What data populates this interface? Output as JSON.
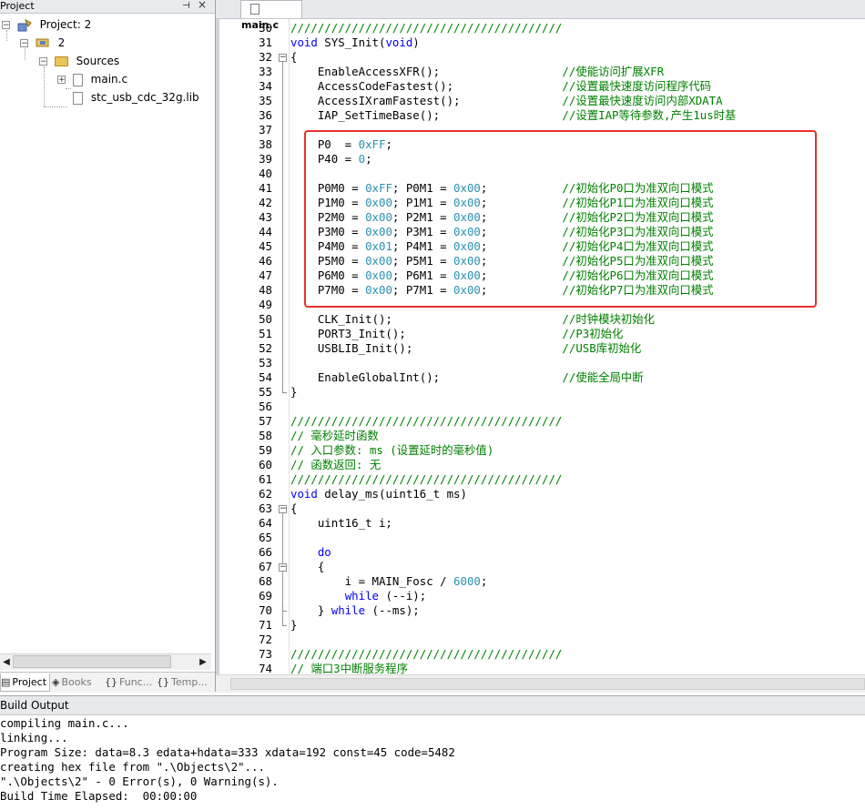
{
  "project_panel": {
    "title": "Project",
    "pin_icon": "pin-icon",
    "close_icon": "close-icon",
    "tree": [
      {
        "label": "Project: 2",
        "level": 0,
        "icon": "project-icon",
        "expander": "−"
      },
      {
        "label": "2",
        "level": 1,
        "icon": "target-icon",
        "expander": "−"
      },
      {
        "label": "Sources",
        "level": 2,
        "icon": "folder-icon",
        "expander": "−"
      },
      {
        "label": "main.c",
        "level": 3,
        "icon": "file-icon",
        "expander": "+"
      },
      {
        "label": "stc_usb_cdc_32g.lib",
        "level": 3,
        "icon": "file-icon",
        "expander": ""
      }
    ],
    "tabs": [
      {
        "label": "Project",
        "glyph": "▤",
        "active": true
      },
      {
        "label": "Books",
        "glyph": "◈",
        "active": false
      },
      {
        "label": "Func...",
        "glyph": "{}",
        "active": false
      },
      {
        "label": "Temp...",
        "glyph": "{}",
        "active": false
      }
    ]
  },
  "editor": {
    "tab_label": "main.c",
    "lines": [
      {
        "n": "30",
        "code": "////////////////////////////////////////",
        "type": "comment"
      },
      {
        "n": "31",
        "code": "void SYS_Init(void)",
        "type": "code"
      },
      {
        "n": "32",
        "code": "{",
        "type": "code"
      },
      {
        "n": "33",
        "code": "    EnableAccessXFR();                  //使能访问扩展XFR",
        "type": "code"
      },
      {
        "n": "34",
        "code": "    AccessCodeFastest();                //设置最快速度访问程序代码",
        "type": "code"
      },
      {
        "n": "35",
        "code": "    AccessIXramFastest();               //设置最快速度访问内部XDATA",
        "type": "code"
      },
      {
        "n": "36",
        "code": "    IAP_SetTimeBase();                  //设置IAP等待参数,产生1us时基",
        "type": "code"
      },
      {
        "n": "37",
        "code": "",
        "type": "code"
      },
      {
        "n": "38",
        "code": "    P0  = 0xFF;",
        "type": "code"
      },
      {
        "n": "39",
        "code": "    P40 = 0;",
        "type": "code"
      },
      {
        "n": "40",
        "code": "",
        "type": "code"
      },
      {
        "n": "41",
        "code": "    P0M0 = 0xFF; P0M1 = 0x00;           //初始化P0口为准双向口模式",
        "type": "code"
      },
      {
        "n": "42",
        "code": "    P1M0 = 0x00; P1M1 = 0x00;           //初始化P1口为准双向口模式",
        "type": "code"
      },
      {
        "n": "43",
        "code": "    P2M0 = 0x00; P2M1 = 0x00;           //初始化P2口为准双向口模式",
        "type": "code"
      },
      {
        "n": "44",
        "code": "    P3M0 = 0x00; P3M1 = 0x00;           //初始化P3口为准双向口模式",
        "type": "code"
      },
      {
        "n": "45",
        "code": "    P4M0 = 0x01; P4M1 = 0x00;           //初始化P4口为准双向口模式",
        "type": "code"
      },
      {
        "n": "46",
        "code": "    P5M0 = 0x00; P5M1 = 0x00;           //初始化P5口为准双向口模式",
        "type": "code"
      },
      {
        "n": "47",
        "code": "    P6M0 = 0x00; P6M1 = 0x00;           //初始化P6口为准双向口模式",
        "type": "code"
      },
      {
        "n": "48",
        "code": "    P7M0 = 0x00; P7M1 = 0x00;           //初始化P7口为准双向口模式",
        "type": "code"
      },
      {
        "n": "49",
        "code": "",
        "type": "code"
      },
      {
        "n": "50",
        "code": "    CLK_Init();                         //时钟模块初始化",
        "type": "code"
      },
      {
        "n": "51",
        "code": "    PORT3_Init();                       //P3初始化",
        "type": "code"
      },
      {
        "n": "52",
        "code": "    USBLIB_Init();                      //USB库初始化",
        "type": "code"
      },
      {
        "n": "53",
        "code": "",
        "type": "code"
      },
      {
        "n": "54",
        "code": "    EnableGlobalInt();                  //使能全局中断",
        "type": "code"
      },
      {
        "n": "55",
        "code": "}",
        "type": "code"
      },
      {
        "n": "56",
        "code": "",
        "type": "code"
      },
      {
        "n": "57",
        "code": "////////////////////////////////////////",
        "type": "comment"
      },
      {
        "n": "58",
        "code": "// 毫秒延时函数",
        "type": "comment"
      },
      {
        "n": "59",
        "code": "// 入口参数: ms (设置延时的毫秒值)",
        "type": "comment"
      },
      {
        "n": "60",
        "code": "// 函数返回: 无",
        "type": "comment"
      },
      {
        "n": "61",
        "code": "////////////////////////////////////////",
        "type": "comment"
      },
      {
        "n": "62",
        "code": "void delay_ms(uint16_t ms)",
        "type": "code"
      },
      {
        "n": "63",
        "code": "{",
        "type": "code"
      },
      {
        "n": "64",
        "code": "    uint16_t i;",
        "type": "code"
      },
      {
        "n": "65",
        "code": "",
        "type": "code"
      },
      {
        "n": "66",
        "code": "    do",
        "type": "code"
      },
      {
        "n": "67",
        "code": "    {",
        "type": "code"
      },
      {
        "n": "68",
        "code": "        i = MAIN_Fosc / 6000;",
        "type": "code"
      },
      {
        "n": "69",
        "code": "        while (--i);",
        "type": "code"
      },
      {
        "n": "70",
        "code": "    } while (--ms);",
        "type": "code"
      },
      {
        "n": "71",
        "code": "}",
        "type": "code"
      },
      {
        "n": "72",
        "code": "",
        "type": "code"
      },
      {
        "n": "73",
        "code": "////////////////////////////////////////",
        "type": "comment"
      },
      {
        "n": "74",
        "code": "// 端口3中断服务程序",
        "type": "comment"
      }
    ],
    "highlight_color": "#e8312a"
  },
  "build_output": {
    "title": "Build Output",
    "lines": [
      "compiling main.c...",
      "linking...",
      "Program Size: data=8.3 edata+hdata=333 xdata=192 const=45 code=5482",
      "creating hex file from \".\\Objects\\2\"...",
      "\".\\Objects\\2\" - 0 Error(s), 0 Warning(s).",
      "Build Time Elapsed:  00:00:00"
    ]
  },
  "colors": {
    "keyword": "#0000ff",
    "number": "#2b91af",
    "comment": "#008000"
  }
}
